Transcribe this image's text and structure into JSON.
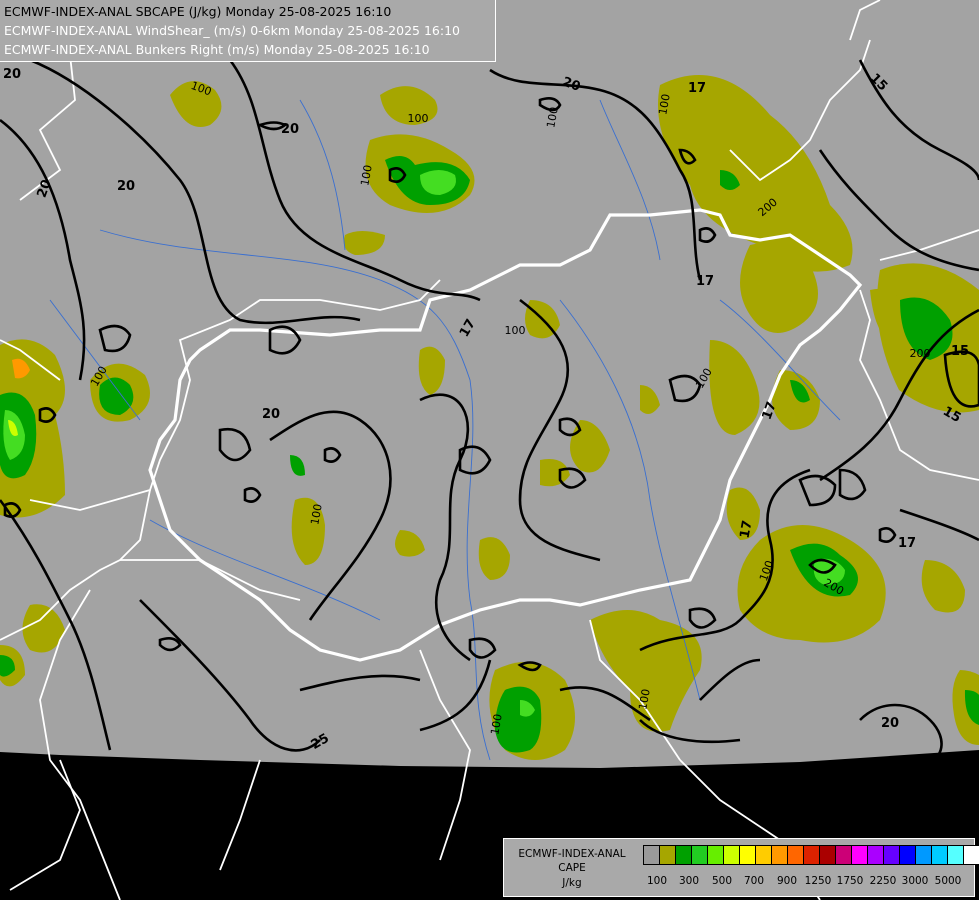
{
  "title": {
    "line1": "ECMWF-INDEX-ANAL SBCAPE (J/kg) Monday 25-08-2025 16:10",
    "line2": "ECMWF-INDEX-ANAL WindShear_ (m/s) 0-6km Monday 25-08-2025 16:10",
    "line3": "ECMWF-INDEX-ANAL Bunkers Right (m/s) Monday 25-08-2025 16:10"
  },
  "legend": {
    "line1": "ECMWF-INDEX-ANAL",
    "line2": "CAPE",
    "line3": "J/kg",
    "colors": [
      "#9a9a9a",
      "#a6a600",
      "#00a000",
      "#22cc22",
      "#66ee00",
      "#ccff00",
      "#ffff00",
      "#ffcc00",
      "#ff9900",
      "#ff6600",
      "#dd2200",
      "#aa0000",
      "#cc0077",
      "#ff00ff",
      "#aa00ff",
      "#6600ff",
      "#0000ff",
      "#0099ff",
      "#00ccff",
      "#55ffff",
      "#ffffff"
    ],
    "tick_labels": [
      "100",
      "300",
      "500",
      "700",
      "900",
      "1250",
      "1750",
      "2250",
      "3000",
      "5000"
    ]
  },
  "contour_labels": [
    {
      "text": "20"
    },
    {
      "text": "20"
    },
    {
      "text": "20"
    },
    {
      "text": "20"
    },
    {
      "text": "20"
    },
    {
      "text": "20"
    },
    {
      "text": "20"
    },
    {
      "text": "17"
    },
    {
      "text": "17"
    },
    {
      "text": "17"
    },
    {
      "text": "17"
    },
    {
      "text": "17"
    },
    {
      "text": "17"
    },
    {
      "text": "15"
    },
    {
      "text": "15"
    },
    {
      "text": "15"
    },
    {
      "text": "25"
    }
  ],
  "cape_labels": [
    {
      "text": "100"
    },
    {
      "text": "100"
    },
    {
      "text": "100"
    },
    {
      "text": "100"
    },
    {
      "text": "100"
    },
    {
      "text": "100"
    },
    {
      "text": "100"
    },
    {
      "text": "100"
    },
    {
      "text": "100"
    },
    {
      "text": "100"
    },
    {
      "text": "100"
    },
    {
      "text": "100"
    },
    {
      "text": "200"
    },
    {
      "text": "200"
    },
    {
      "text": "200"
    }
  ]
}
